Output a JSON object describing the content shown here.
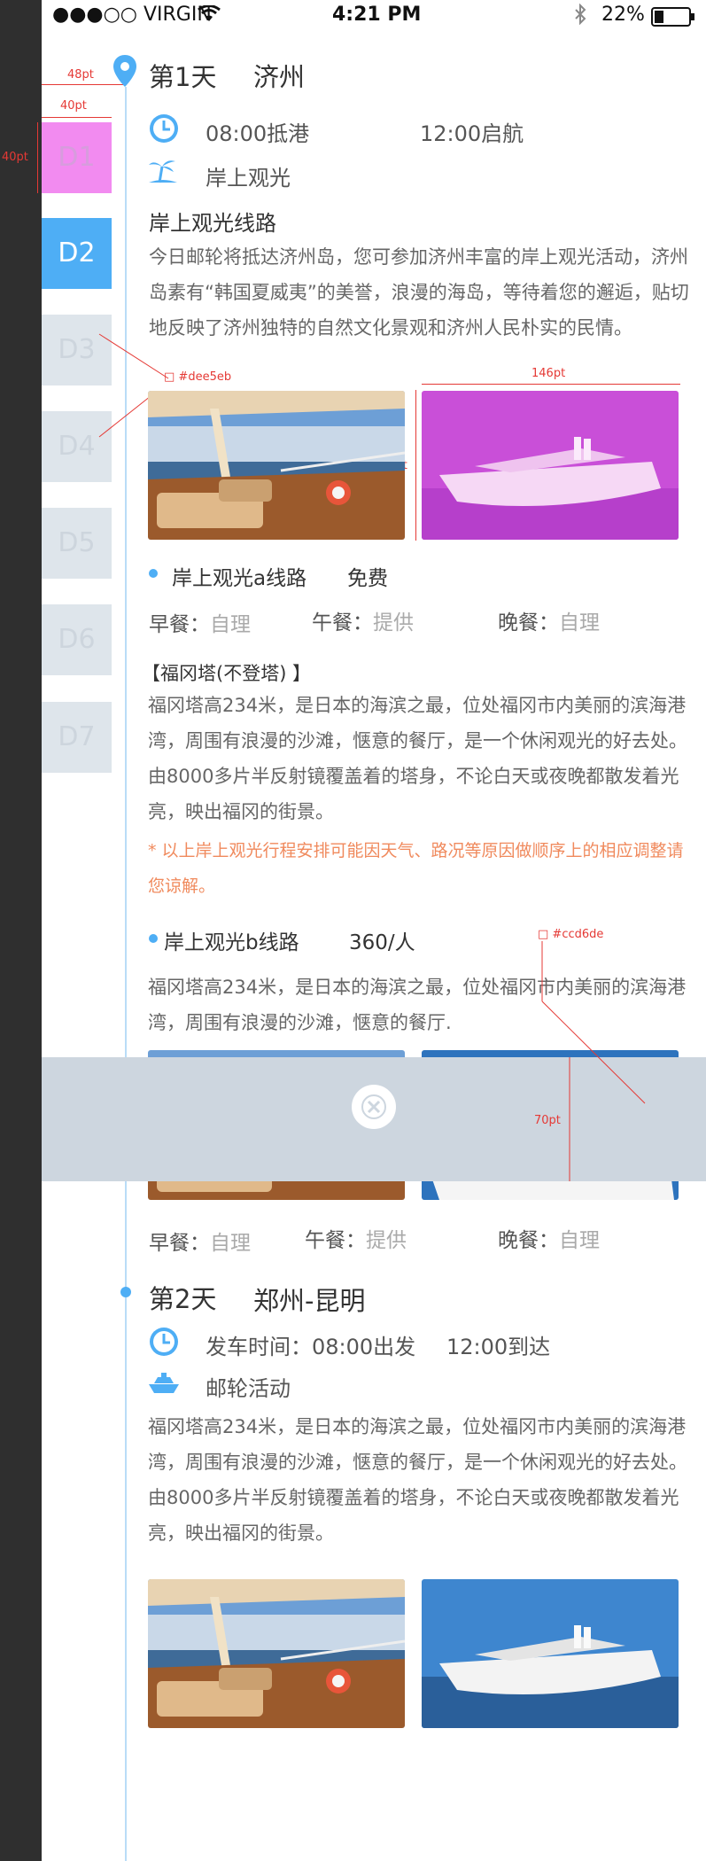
{
  "status_bar": {
    "carrier": "●●●○○ VIRGIN",
    "time": "4:21 PM",
    "battery": "22%"
  },
  "days_nav": [
    {
      "label": "D1"
    },
    {
      "label": "D2"
    },
    {
      "label": "D3"
    },
    {
      "label": "D4"
    },
    {
      "label": "D5"
    },
    {
      "label": "D6"
    },
    {
      "label": "D7"
    }
  ],
  "annotations": {
    "w48": "48pt",
    "w40": "40pt",
    "h40": "40pt",
    "color_dee5eb": "#dee5eb",
    "color_b3bec7": "#b3bec7",
    "w146": "146pt",
    "h86": "86pt",
    "color_ccd6de": "#ccd6de",
    "h70": "70pt"
  },
  "day1": {
    "day": "第1天",
    "city": "济州",
    "arrive": "08:00抵港",
    "depart": "12:00启航",
    "activity": "岸上观光",
    "route_title": "岸上观光线路",
    "route_desc": "今日邮轮将抵达济州岛，您可参加济州丰富的岸上观光活动，济州岛素有“韩国夏威夷”的美誉，浪漫的海岛，等待着您的邂逅，贴切地反映了济州独特的自然文化景观和济州人民朴实的民情。",
    "line_a": {
      "name": "岸上观光a线路",
      "price": "免费"
    },
    "meals_a": {
      "breakfast_label": "早餐：",
      "breakfast": "自理",
      "lunch_label": "午餐：",
      "lunch": "提供",
      "dinner_label": "晚餐：",
      "dinner": "自理"
    },
    "poi_title": "【福冈塔(不登塔) 】",
    "poi_desc": "福冈塔高234米，是日本的海滨之最，位处福冈市内美丽的滨海港湾，周围有浪漫的沙滩，惬意的餐厅，是一个休闲观光的好去处。由8000多片半反射镜覆盖着的塔身，不论白天或夜晚都散发着光亮，映出福冈的街景。",
    "note": "* 以上岸上观光行程安排可能因天气、路况等原因做顺序上的相应调整请您谅解。",
    "line_b": {
      "name": "岸上观光b线路",
      "price": "360/人"
    },
    "line_b_desc": "福冈塔高234米，是日本的海滨之最，位处福冈市内美丽的滨海港湾，周围有浪漫的沙滩，惬意的餐厅.",
    "meals_b": {
      "breakfast_label": "早餐：",
      "breakfast": "自理",
      "lunch_label": "午餐：",
      "lunch": "提供",
      "dinner_label": "晚餐：",
      "dinner": "自理"
    }
  },
  "day2": {
    "day": "第2天",
    "city": "郑州-昆明",
    "depart": "发车时间：08:00出发",
    "arrive": "12:00到达",
    "activity": "邮轮活动",
    "desc": "福冈塔高234米，是日本的海滨之最，位处福冈市内美丽的滨海港湾，周围有浪漫的沙滩，惬意的餐厅，是一个休闲观光的好去处。由8000多片半反射镜覆盖着的塔身，不论白天或夜晚都散发着光亮，映出福冈的街景。"
  },
  "colors": {
    "accent": "#4eaef5",
    "inactive_tab": "#dee5eb",
    "overlay": "#cdd6df",
    "note": "#f08a5d"
  }
}
